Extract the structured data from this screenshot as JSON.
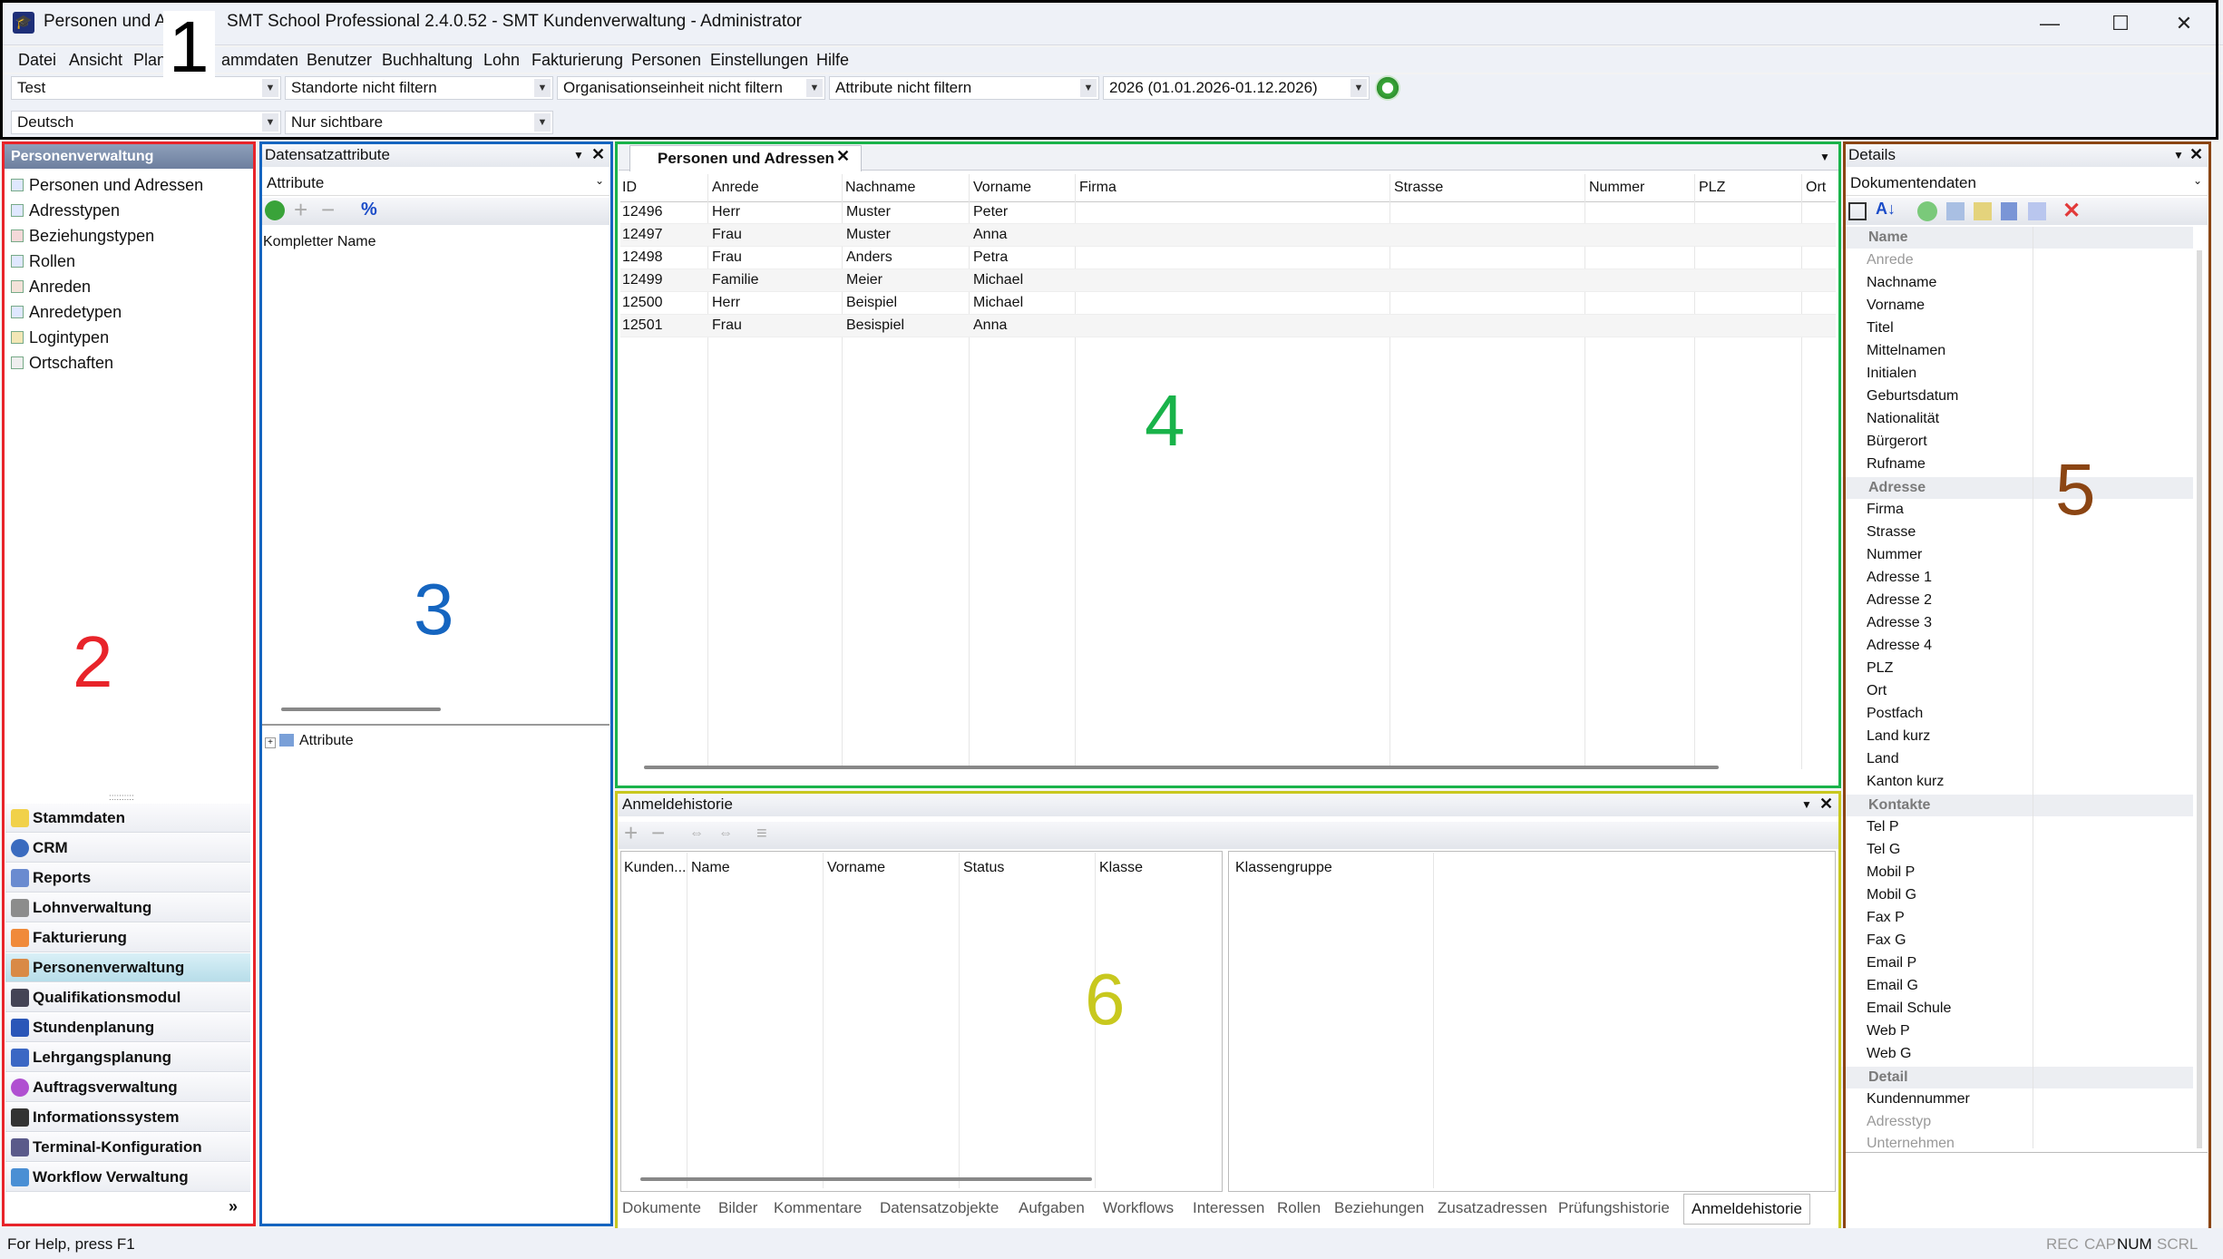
{
  "window": {
    "title_left": "Personen und Ad",
    "title_right": "SMT School Professional 2.4.0.52 - SMT Kundenverwaltung - Administrator",
    "minimize": "—",
    "maximize": "☐",
    "close": "✕"
  },
  "menu": [
    "Datei",
    "Ansicht",
    "Plan",
    "ammdaten",
    "Benutzer",
    "Buchhaltung",
    "Lohn",
    "Fakturierung",
    "Personen",
    "Einstellungen",
    "Hilfe"
  ],
  "filters": {
    "row1": [
      "Test",
      "Standorte nicht filtern",
      "Organisationseinheit nicht filtern",
      "Attribute nicht filtern",
      "2026 (01.01.2026-01.12.2026)"
    ],
    "row2": [
      "Deutsch",
      "Nur sichtbare"
    ]
  },
  "annotations": {
    "n1": "1",
    "n2": "2",
    "n3": "3",
    "n4": "4",
    "n5": "5",
    "n6": "6",
    "colors": {
      "n1": "#000000",
      "n2": "#e8242a",
      "n3": "#1565c0",
      "n4": "#19b34a",
      "n5": "#8b4513",
      "n6": "#c8c81e"
    }
  },
  "nav": {
    "header": "Personenverwaltung",
    "tree": [
      "Personen und Adressen",
      "Adresstypen",
      "Beziehungstypen",
      "Rollen",
      "Anreden",
      "Anredetypen",
      "Logintypen",
      "Ortschaften"
    ],
    "grip": "::::::::::",
    "buttons": [
      "Stammdaten",
      "CRM",
      "Reports",
      "Lohnverwaltung",
      "Fakturierung",
      "Personenverwaltung",
      "Qualifikationsmodul",
      "Stundenplanung",
      "Lehrgangsplanung",
      "Auftragsverwaltung",
      "Informationssystem",
      "Terminal-Konfiguration",
      "Workflow Verwaltung"
    ],
    "active": "Personenverwaltung",
    "more": "»"
  },
  "attributes_panel": {
    "title": "Datensatzattribute",
    "dropdown": "Attribute",
    "column": "Kompletter Name",
    "tree_item": "Attribute",
    "expander": "+"
  },
  "main_tab": {
    "label": "Personen und Adressen",
    "columns": [
      "ID",
      "Anrede",
      "Nachname",
      "Vorname",
      "Firma",
      "Strasse",
      "Nummer",
      "PLZ",
      "Ort"
    ],
    "rows": [
      [
        "12496",
        "Herr",
        "Muster",
        "Peter"
      ],
      [
        "12497",
        "Frau",
        "Muster",
        "Anna"
      ],
      [
        "12498",
        "Frau",
        "Anders",
        "Petra"
      ],
      [
        "12499",
        "Familie",
        "Meier",
        "Michael"
      ],
      [
        "12500",
        "Herr",
        "Beispiel",
        "Michael"
      ],
      [
        "12501",
        "Frau",
        "Besispiel",
        "Anna"
      ]
    ]
  },
  "login_history": {
    "title": "Anmeldehistorie",
    "left_columns": [
      "Kunden...",
      "Name",
      "Vorname",
      "Status",
      "Klasse"
    ],
    "right_columns": [
      "Klassengruppe"
    ],
    "tabs": [
      "Dokumente",
      "Bilder",
      "Kommentare",
      "Datensatzobjekte",
      "Aufgaben",
      "Workflows",
      "Interessen",
      "Rollen",
      "Beziehungen",
      "Zusatzadressen",
      "Prüfungshistorie",
      "Anmeldehistorie"
    ],
    "active_tab": "Anmeldehistorie"
  },
  "details": {
    "title": "Details",
    "dropdown": "Dokumentendaten",
    "categories": [
      {
        "name": "Name",
        "fields": [
          "Anrede",
          "Nachname",
          "Vorname",
          "Titel",
          "Mittelnamen",
          "Initialen",
          "Geburtsdatum",
          "Nationalität",
          "Bürgerort",
          "Rufname"
        ]
      },
      {
        "name": "Adresse",
        "fields": [
          "Firma",
          "Strasse",
          "Nummer",
          "Adresse 1",
          "Adresse 2",
          "Adresse 3",
          "Adresse 4",
          "PLZ",
          "Ort",
          "Postfach",
          "Land kurz",
          "Land",
          "Kanton kurz"
        ]
      },
      {
        "name": "Kontakte",
        "fields": [
          "Tel P",
          "Tel G",
          "Mobil P",
          "Mobil G",
          "Fax P",
          "Fax G",
          "Email P",
          "Email G",
          "Email Schule",
          "Web P",
          "Web G"
        ]
      },
      {
        "name": "Detail",
        "fields": [
          "Kundennummer",
          "Adresstyp",
          "Unternehmen"
        ]
      }
    ],
    "grey_fields": [
      "Anrede",
      "Adresstyp",
      "Unternehmen"
    ]
  },
  "status": {
    "help": "For Help, press F1",
    "rec": "REC",
    "cap": "CAP",
    "num": "NUM",
    "scrl": "SCRL"
  }
}
